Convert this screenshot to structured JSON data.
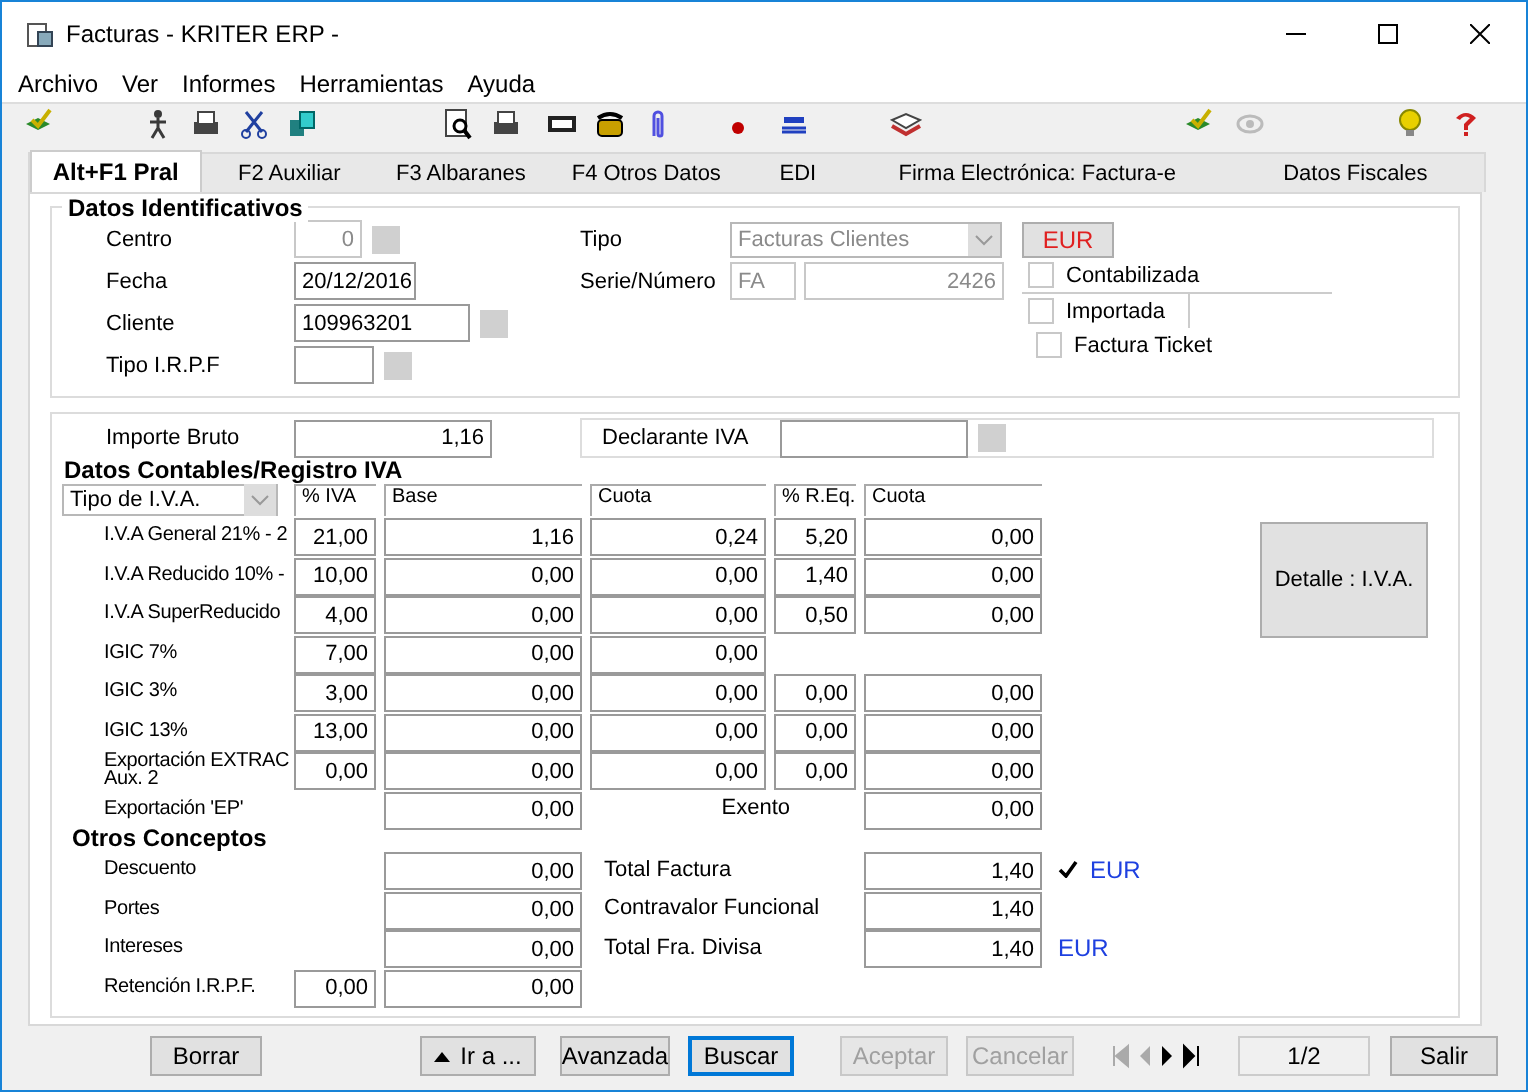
{
  "window": {
    "title": "Facturas - KRITER ERP -"
  },
  "menu": [
    "Archivo",
    "Ver",
    "Informes",
    "Herramientas",
    "Ayuda"
  ],
  "tabs": [
    {
      "label": "Alt+F1 Pral",
      "selected": true
    },
    {
      "label": "F2 Auxiliar",
      "selected": false
    },
    {
      "label": "F3 Albaranes",
      "selected": false
    },
    {
      "label": "F4 Otros Datos",
      "selected": false
    },
    {
      "label": "EDI",
      "selected": false
    },
    {
      "label": "Firma Electrónica: Factura-e",
      "selected": false
    },
    {
      "label": "Datos Fiscales",
      "selected": false
    }
  ],
  "identificativos": {
    "title": "Datos Identificativos",
    "centro": {
      "label": "Centro",
      "value": "0",
      "disabled": true
    },
    "fecha": {
      "label": "Fecha",
      "value": "20/12/2016"
    },
    "cliente": {
      "label": "Cliente",
      "value": "109963201"
    },
    "tipo_irpf": {
      "label": "Tipo I.R.P.F"
    },
    "tipo": {
      "label": "Tipo",
      "value": "Facturas Clientes",
      "disabled": true
    },
    "serie": {
      "label": "Serie/Número",
      "serie": "FA",
      "numero": "2426",
      "disabled": true
    },
    "currency_button": "EUR",
    "checkboxes": [
      {
        "label": "Contabilizada",
        "checked": false
      },
      {
        "label": "Importada",
        "checked": false
      },
      {
        "label": "Factura Ticket",
        "checked": false
      }
    ]
  },
  "importe_bruto": {
    "label": "Importe Bruto",
    "value": "1,16"
  },
  "declarante": {
    "label": "Declarante IVA"
  },
  "contables": {
    "title": "Datos Contables/Registro IVA",
    "type_combo": "Tipo de I.V.A.",
    "columns": [
      "% IVA",
      "Base",
      "Cuota",
      "% R.Eq.",
      "Cuota"
    ],
    "rows": [
      {
        "label": "I.V.A General 21% - 2",
        "pct": "21,00",
        "base": "1,16",
        "cuota": "0,24",
        "req": "5,20",
        "req_cuota": "0,00"
      },
      {
        "label": "I.V.A Reducido 10% -",
        "pct": "10,00",
        "base": "0,00",
        "cuota": "0,00",
        "req": "1,40",
        "req_cuota": "0,00"
      },
      {
        "label": "I.V.A SuperReducido",
        "pct": "4,00",
        "base": "0,00",
        "cuota": "0,00",
        "req": "0,50",
        "req_cuota": "0,00"
      },
      {
        "label": "IGIC 7%",
        "pct": "7,00",
        "base": "0,00",
        "cuota": "0,00"
      },
      {
        "label": "IGIC 3%",
        "pct": "3,00",
        "base": "0,00",
        "cuota": "0,00",
        "req": "0,00",
        "req_cuota": "0,00"
      },
      {
        "label": "IGIC 13%",
        "pct": "13,00",
        "base": "0,00",
        "cuota": "0,00",
        "req": "0,00",
        "req_cuota": "0,00"
      },
      {
        "label": "Exportación EXTRAC\nAux. 2",
        "pct": "0,00",
        "base": "0,00",
        "cuota": "0,00",
        "req": "0,00",
        "req_cuota": "0,00"
      }
    ],
    "detalle_button": "Detalle : I.V.A.",
    "exportacion_ep": {
      "label": "Exportación 'EP'",
      "value": "0,00"
    },
    "exento": {
      "label": "Exento",
      "value": "0,00"
    }
  },
  "otros": {
    "title": "Otros Conceptos",
    "rows": [
      {
        "label": "Descuento",
        "value": "0,00",
        "total_label": "Total Factura",
        "total": "1,40",
        "checked": true,
        "currency": "EUR"
      },
      {
        "label": "Portes",
        "value": "0,00",
        "total_label": "Contravalor Funcional",
        "total": "1,40",
        "checked": false
      },
      {
        "label": "Intereses",
        "value": "0,00",
        "total_label": "Total Fra. Divisa",
        "total": "1,40",
        "checked": false,
        "currency": "EUR"
      },
      {
        "label": "Retención I.R.P.F.",
        "pct": "0,00",
        "value": "0,00"
      }
    ]
  },
  "buttons": [
    {
      "label": "Borrar",
      "disabled": false,
      "default": false
    },
    {
      "label": "Ir a ...",
      "disabled": false,
      "default": false,
      "kind": "menu"
    },
    {
      "label": "Avanzada",
      "disabled": false,
      "default": false
    },
    {
      "label": "Buscar",
      "disabled": false,
      "default": true
    },
    {
      "label": "Aceptar",
      "disabled": true,
      "default": false
    },
    {
      "label": "Cancelar",
      "disabled": true,
      "default": false
    }
  ],
  "record_position": "1/2",
  "exit_button": "Salir"
}
